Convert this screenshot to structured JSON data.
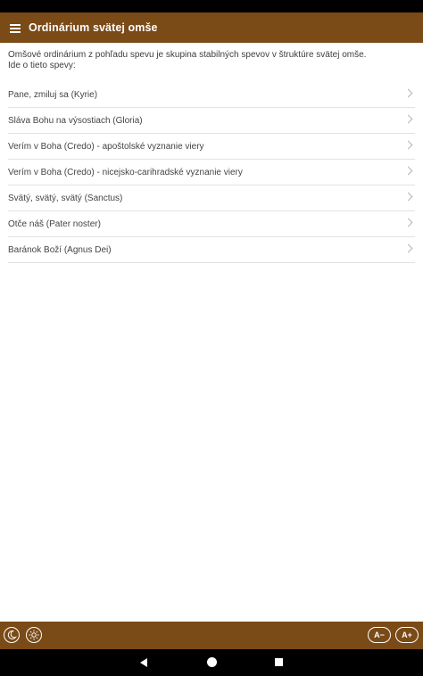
{
  "app": {
    "title": "Ordinárium svätej omše"
  },
  "intro": {
    "line1": "Omšové ordinárium z pohľadu spevu je skupina stabilných spevov v štruktúre svätej omše.",
    "line2": "Ide o tieto spevy:"
  },
  "items": [
    {
      "label": "Pane, zmiluj sa (Kyrie)"
    },
    {
      "label": "Sláva Bohu na výsostiach (Gloria)"
    },
    {
      "label": "Verím v Boha (Credo) - apoštolské vyznanie viery"
    },
    {
      "label": "Verím v Boha (Credo) - nicejsko-carihradské vyznanie viery"
    },
    {
      "label": "Svätý, svätý, svätý (Sanctus)"
    },
    {
      "label": "Otče náš (Pater noster)"
    },
    {
      "label": "Baránok Boží (Agnus Dei)"
    }
  ],
  "bottom": {
    "font_decrease": "A−",
    "font_increase": "A+"
  },
  "icons": {
    "menu": "hamburger-menu-icon",
    "chevron": "chevron-right-icon",
    "night": "moon-icon",
    "day": "sun-icon"
  },
  "colors": {
    "primary": "#7a4a17"
  }
}
